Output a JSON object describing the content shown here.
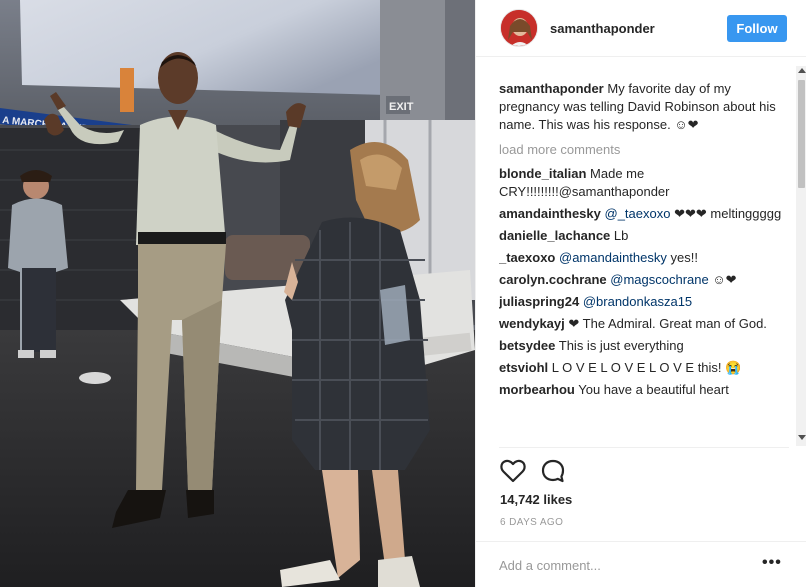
{
  "post": {
    "photo_alt": "",
    "header": {
      "username": "samanthaponder",
      "follow_label": "Follow"
    },
    "caption": {
      "user": "samanthaponder",
      "text": "My favorite day of my pregnancy was telling David Robinson about his name. This was his response. ☺❤"
    },
    "load_more_label": "load more comments",
    "comments": [
      {
        "user": "blonde_italian",
        "text": "Made me CRY!!!!!!!!!@samanthaponder",
        "mention": ""
      },
      {
        "user": "amandainthesky",
        "mention": "@_taexoxo",
        "text": "❤❤❤ meltinggggg"
      },
      {
        "user": "danielle_lachance",
        "mention": "",
        "text": "Lb"
      },
      {
        "user": "_taexoxo",
        "mention": "@amandainthesky",
        "text": "yes!!"
      },
      {
        "user": "carolyn.cochrane",
        "mention": "@magscochrane",
        "text": "☺❤"
      },
      {
        "user": "juliaspring24",
        "mention": "@brandonkasza15",
        "text": ""
      },
      {
        "user": "wendykayj",
        "mention": "",
        "text": "❤ The Admiral. Great man of God."
      },
      {
        "user": "betsydee",
        "mention": "",
        "text": "This is just everything"
      },
      {
        "user": "etsviohl",
        "mention": "",
        "text": "L O V E L O V E L O V E this! 😭"
      },
      {
        "user": "morbearhou",
        "mention": "",
        "text": "You have a beautiful heart"
      }
    ],
    "likes": "14,742 likes",
    "timestamp": "6 DAYS AGO",
    "add_comment_placeholder": "Add a comment...",
    "more_options_label": "•••",
    "colors": {
      "follow_button": "#3897f0",
      "mention": "#003569",
      "muted": "#999999"
    },
    "icons": {
      "like": "heart-icon",
      "comment": "speech-bubble-icon",
      "more": "ellipsis-icon"
    }
  },
  "scene_text": {
    "exit_sign": "EXIT",
    "banner": "A MARCH MADNESS"
  }
}
